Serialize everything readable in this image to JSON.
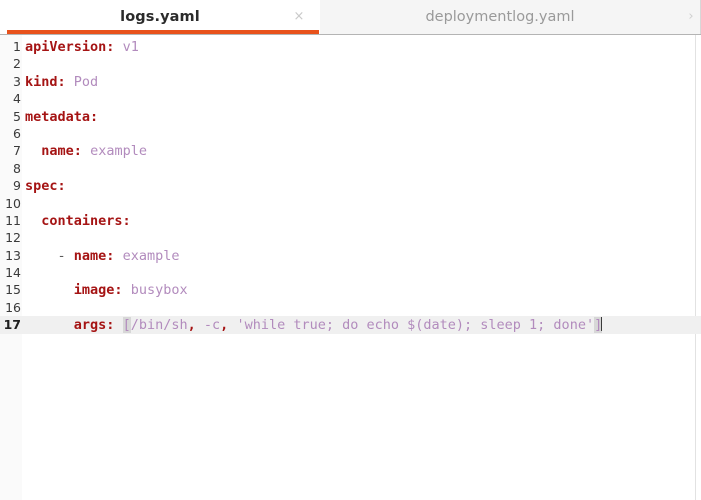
{
  "window": {
    "accent_color": "#e8521c",
    "tabbar_bg": "#f5f5f5",
    "editor_bg": "#ffffff",
    "current_line_bg": "#f0f0f0",
    "key_color": "#a51414",
    "value_color": "#b28bbd"
  },
  "tabs": {
    "items": [
      {
        "label": "logs.yaml",
        "active": true,
        "close_icon": "×"
      },
      {
        "label": "deploymentlog.yaml",
        "active": false
      }
    ],
    "scroll_right_icon": "›"
  },
  "editor": {
    "current_line": 17,
    "lines": [
      {
        "n": "1",
        "segments": [
          {
            "t": "apiVersion",
            "c": "k"
          },
          {
            "t": ":",
            "c": "p"
          },
          {
            "t": " ",
            "c": "d"
          },
          {
            "t": "v1",
            "c": "v"
          }
        ]
      },
      {
        "n": "2",
        "segments": []
      },
      {
        "n": "3",
        "segments": [
          {
            "t": "kind",
            "c": "k"
          },
          {
            "t": ":",
            "c": "p"
          },
          {
            "t": " ",
            "c": "d"
          },
          {
            "t": "Pod",
            "c": "v"
          }
        ]
      },
      {
        "n": "4",
        "segments": []
      },
      {
        "n": "5",
        "segments": [
          {
            "t": "metadata",
            "c": "k"
          },
          {
            "t": ":",
            "c": "p"
          }
        ]
      },
      {
        "n": "6",
        "segments": []
      },
      {
        "n": "7",
        "segments": [
          {
            "t": "  ",
            "c": "d"
          },
          {
            "t": "name",
            "c": "k"
          },
          {
            "t": ":",
            "c": "p"
          },
          {
            "t": " ",
            "c": "d"
          },
          {
            "t": "example",
            "c": "v"
          }
        ]
      },
      {
        "n": "8",
        "segments": []
      },
      {
        "n": "9",
        "segments": [
          {
            "t": "spec",
            "c": "k"
          },
          {
            "t": ":",
            "c": "p"
          }
        ]
      },
      {
        "n": "10",
        "segments": []
      },
      {
        "n": "11",
        "segments": [
          {
            "t": "  ",
            "c": "d"
          },
          {
            "t": "containers",
            "c": "k"
          },
          {
            "t": ":",
            "c": "p"
          }
        ]
      },
      {
        "n": "12",
        "segments": []
      },
      {
        "n": "13",
        "segments": [
          {
            "t": "    - ",
            "c": "d"
          },
          {
            "t": "name",
            "c": "k"
          },
          {
            "t": ":",
            "c": "p"
          },
          {
            "t": " ",
            "c": "d"
          },
          {
            "t": "example",
            "c": "v"
          }
        ]
      },
      {
        "n": "14",
        "segments": []
      },
      {
        "n": "15",
        "segments": [
          {
            "t": "      ",
            "c": "d"
          },
          {
            "t": "image",
            "c": "k"
          },
          {
            "t": ":",
            "c": "p"
          },
          {
            "t": " ",
            "c": "d"
          },
          {
            "t": "busybox",
            "c": "v"
          }
        ]
      },
      {
        "n": "16",
        "segments": []
      },
      {
        "n": "17",
        "segments": [
          {
            "t": "      ",
            "c": "d"
          },
          {
            "t": "args",
            "c": "k"
          },
          {
            "t": ":",
            "c": "p"
          },
          {
            "t": " ",
            "c": "d"
          },
          {
            "t": "[",
            "c": "sel"
          },
          {
            "t": "/bin/sh",
            "c": "v"
          },
          {
            "t": ",",
            "c": "p"
          },
          {
            "t": " ",
            "c": "d"
          },
          {
            "t": "-c",
            "c": "v"
          },
          {
            "t": ",",
            "c": "p"
          },
          {
            "t": " ",
            "c": "d"
          },
          {
            "t": "'while true; do echo $(date); sleep 1; done'",
            "c": "v"
          },
          {
            "t": "]",
            "c": "sel"
          }
        ],
        "caret_at_end": true
      }
    ]
  }
}
